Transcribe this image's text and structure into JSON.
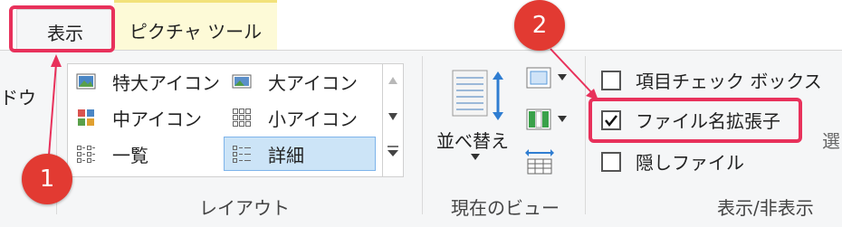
{
  "tabs": [
    {
      "label": "表示",
      "selected": true
    },
    {
      "label": "ピクチャ ツール",
      "selected": false
    }
  ],
  "pane_group": {
    "partial_label": "ドウ"
  },
  "layout_group": {
    "label": "レイアウト",
    "items": [
      {
        "label": "特大アイコン",
        "icon": "extra-large-icons-icon"
      },
      {
        "label": "大アイコン",
        "icon": "large-icons-icon"
      },
      {
        "label": "中アイコン",
        "icon": "medium-icons-icon"
      },
      {
        "label": "小アイコン",
        "icon": "small-icons-icon"
      },
      {
        "label": "一覧",
        "icon": "list-icon"
      },
      {
        "label": "詳細",
        "icon": "details-icon",
        "selected": true
      }
    ]
  },
  "current_view_group": {
    "label": "現在のビュー",
    "sort_label": "並べ替え"
  },
  "show_hide_group": {
    "label": "表示/非表示",
    "checkboxes": [
      {
        "label": "項目チェック ボックス",
        "checked": false
      },
      {
        "label": "ファイル名拡張子",
        "checked": true
      },
      {
        "label": "隠しファイル",
        "checked": false
      }
    ],
    "partial_label": "選"
  },
  "annotations": {
    "badge1": "1",
    "badge2": "2",
    "highlight_color": "#e8315b",
    "badge_color": "#e23a32"
  }
}
